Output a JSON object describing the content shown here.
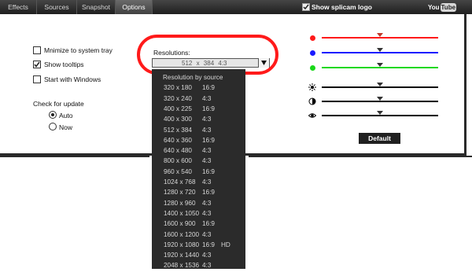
{
  "tabs": [
    {
      "label": "Effects"
    },
    {
      "label": "Sources"
    },
    {
      "label": "Snapshot"
    },
    {
      "label": "Options",
      "active": true
    }
  ],
  "header": {
    "show_logo_label": "Show splicam logo",
    "show_logo_checked": true,
    "youtube": {
      "part1": "You",
      "part2": "Tube"
    }
  },
  "options": {
    "minimize_label": "Mnimize to system tray",
    "minimize_checked": false,
    "tooltips_label": "Show tooltips",
    "tooltips_checked": true,
    "startup_label": "Start with Windows",
    "startup_checked": false,
    "update_title": "Check for update",
    "update_auto_label": "Auto",
    "update_now_label": "Now",
    "update_selected": "Auto"
  },
  "resolution": {
    "label": "Resolutions:",
    "selected_value": "512 x 384",
    "selected_aspect": "4:3",
    "items": [
      {
        "res": "Resolution by source",
        "aspect": "",
        "extra": ""
      },
      {
        "res": "320 x 180",
        "aspect": "16:9",
        "extra": ""
      },
      {
        "res": "320 x 240",
        "aspect": "4:3",
        "extra": ""
      },
      {
        "res": "400 x 225",
        "aspect": "16:9",
        "extra": ""
      },
      {
        "res": "400 x 300",
        "aspect": "4:3",
        "extra": ""
      },
      {
        "res": "512 x 384",
        "aspect": "4:3",
        "extra": ""
      },
      {
        "res": "640 x 360",
        "aspect": "16:9",
        "extra": ""
      },
      {
        "res": "640 x 480",
        "aspect": "4:3",
        "extra": ""
      },
      {
        "res": "800 x 600",
        "aspect": "4:3",
        "extra": ""
      },
      {
        "res": "960 x 540",
        "aspect": "16:9",
        "extra": ""
      },
      {
        "res": "1024 x 768",
        "aspect": "4:3",
        "extra": ""
      },
      {
        "res": "1280 x 720",
        "aspect": "16:9",
        "extra": ""
      },
      {
        "res": "1280 x 960",
        "aspect": "4:3",
        "extra": ""
      },
      {
        "res": "1400 x 1050",
        "aspect": "4:3",
        "extra": ""
      },
      {
        "res": "1600 x 900",
        "aspect": "16:9",
        "extra": ""
      },
      {
        "res": "1600 x 1200",
        "aspect": "4:3",
        "extra": ""
      },
      {
        "res": "1920 x 1080",
        "aspect": "16:9",
        "extra": "HD"
      },
      {
        "res": "1920 x 1440",
        "aspect": "4:3",
        "extra": ""
      },
      {
        "res": "2048 x 1536",
        "aspect": "4:3",
        "extra": ""
      }
    ]
  },
  "sliders": [
    {
      "name": "red",
      "color": "#ff1a1a",
      "icon": "red-dot-icon",
      "value": 0.5
    },
    {
      "name": "blue",
      "color": "#1a1aff",
      "icon": "blue-dot-icon",
      "value": 0.5
    },
    {
      "name": "green",
      "color": "#1ad81a",
      "icon": "green-dot-icon",
      "value": 0.5
    },
    {
      "name": "brightness",
      "color": "#000000",
      "icon": "brightness-icon",
      "value": 0.5
    },
    {
      "name": "contrast",
      "color": "#000000",
      "icon": "contrast-icon",
      "value": 0.5
    },
    {
      "name": "saturation",
      "color": "#000000",
      "icon": "eye-icon",
      "value": 0.5
    }
  ],
  "default_button": "Default"
}
